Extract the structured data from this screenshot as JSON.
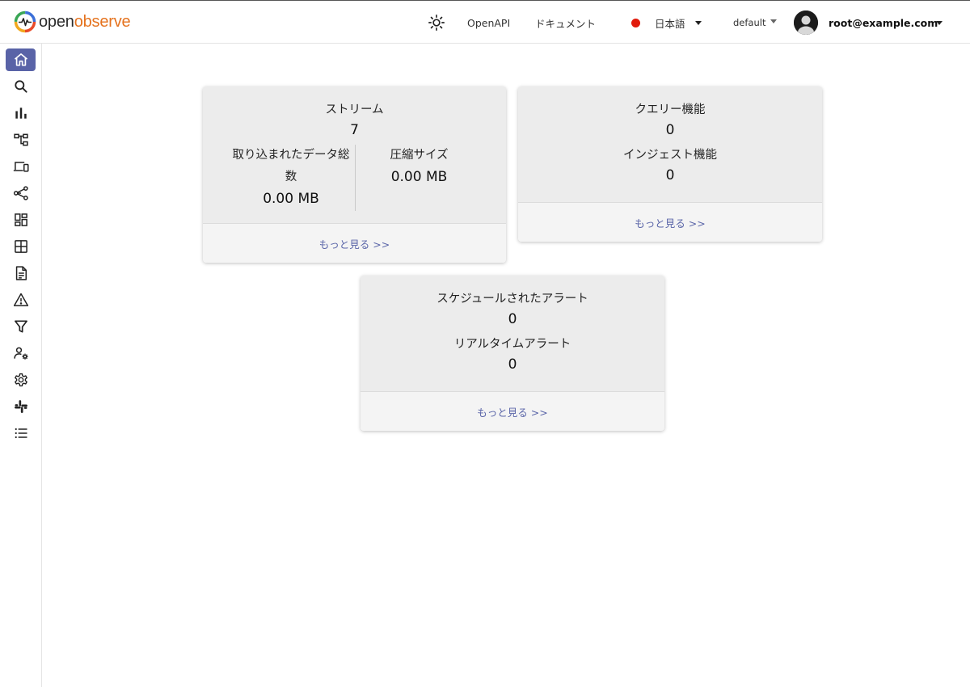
{
  "app": {
    "logo_open": "open",
    "logo_observe": "observe"
  },
  "header": {
    "openapi_label": "OpenAPI",
    "docs_label": "ドキュメント",
    "language": "日本語",
    "language_flag_color": "#e11b0c",
    "organization": "default",
    "user_email": "root@example.com",
    "theme_icon": "sun-icon"
  },
  "sidebar": {
    "active_color": "#5963a7",
    "items": [
      {
        "icon": "home-icon",
        "active": true
      },
      {
        "icon": "search-icon"
      },
      {
        "icon": "bar-chart-icon"
      },
      {
        "icon": "hierarchy-icon"
      },
      {
        "icon": "devices-icon"
      },
      {
        "icon": "share-icon"
      },
      {
        "icon": "dashboard-icon"
      },
      {
        "icon": "table-grid-icon"
      },
      {
        "icon": "document-icon"
      },
      {
        "icon": "warning-icon"
      },
      {
        "icon": "filter-icon"
      },
      {
        "icon": "user-settings-icon"
      },
      {
        "icon": "gear-icon"
      },
      {
        "icon": "slack-icon"
      },
      {
        "icon": "list-icon"
      }
    ]
  },
  "cards": {
    "streams": {
      "title": "ストリーム",
      "count": "7",
      "ingested_label": "取り込まれたデータ総数",
      "ingested_value": "0.00 MB",
      "compressed_label": "圧縮サイズ",
      "compressed_value": "0.00 MB",
      "more_label": "もっと見る >>"
    },
    "functions": {
      "query_label": "クエリー機能",
      "query_value": "0",
      "ingest_label": "インジェスト機能",
      "ingest_value": "0",
      "more_label": "もっと見る >>"
    },
    "alerts": {
      "scheduled_label": "スケジュールされたアラート",
      "scheduled_value": "0",
      "realtime_label": "リアルタイムアラート",
      "realtime_value": "0",
      "more_label": "もっと見る >>"
    }
  }
}
